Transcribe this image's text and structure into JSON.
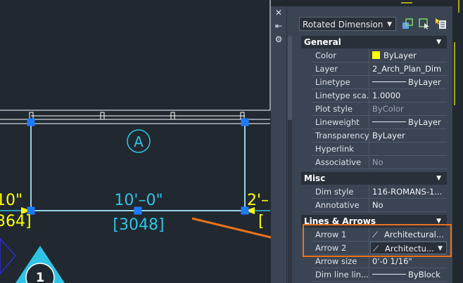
{
  "drawing": {
    "dimension_text": "10'–0\"",
    "dimension_alt": "[3048]",
    "grid_bubble_label": "A",
    "left_dim_text": "10\"",
    "left_dim_alt": "364]",
    "right_dim_text": "2'–",
    "right_dim_alt": "[",
    "section_marker_label": "1"
  },
  "palette": {
    "object_type": "Rotated Dimension",
    "sections": [
      {
        "title": "General",
        "rows": [
          {
            "label": "Color",
            "value": "ByLayer",
            "swatch": "#ffff00"
          },
          {
            "label": "Layer",
            "value": "2_Arch_Plan_Dim"
          },
          {
            "label": "Linetype",
            "value": "ByLayer",
            "line": true
          },
          {
            "label": "Linetype sca...",
            "value": "1.0000"
          },
          {
            "label": "Plot style",
            "value": "ByColor",
            "dim": true
          },
          {
            "label": "Lineweight",
            "value": "ByLayer",
            "line": true
          },
          {
            "label": "Transparency",
            "value": "ByLayer"
          },
          {
            "label": "Hyperlink",
            "value": ""
          },
          {
            "label": "Associative",
            "value": "No",
            "dim": true
          }
        ]
      },
      {
        "title": "Misc",
        "rows": [
          {
            "label": "Dim style",
            "value": "116-ROMANS-1..."
          },
          {
            "label": "Annotative",
            "value": "No"
          }
        ]
      },
      {
        "title": "Lines & Arrows",
        "rows": [
          {
            "label": "Arrow 1",
            "value": "Architectural..."
          },
          {
            "label": "Arrow 2",
            "value": "Architectu..."
          },
          {
            "label": "Arrow size",
            "value": "0'-0 1/16\""
          },
          {
            "label": "Dim line lin...",
            "value": "ByBlock",
            "line": true
          }
        ]
      }
    ]
  },
  "colors": {
    "dimension": "#2ec4e6",
    "selected_text": "#ffff00",
    "grip": "#1e7bff",
    "callout": "#e8731b"
  }
}
